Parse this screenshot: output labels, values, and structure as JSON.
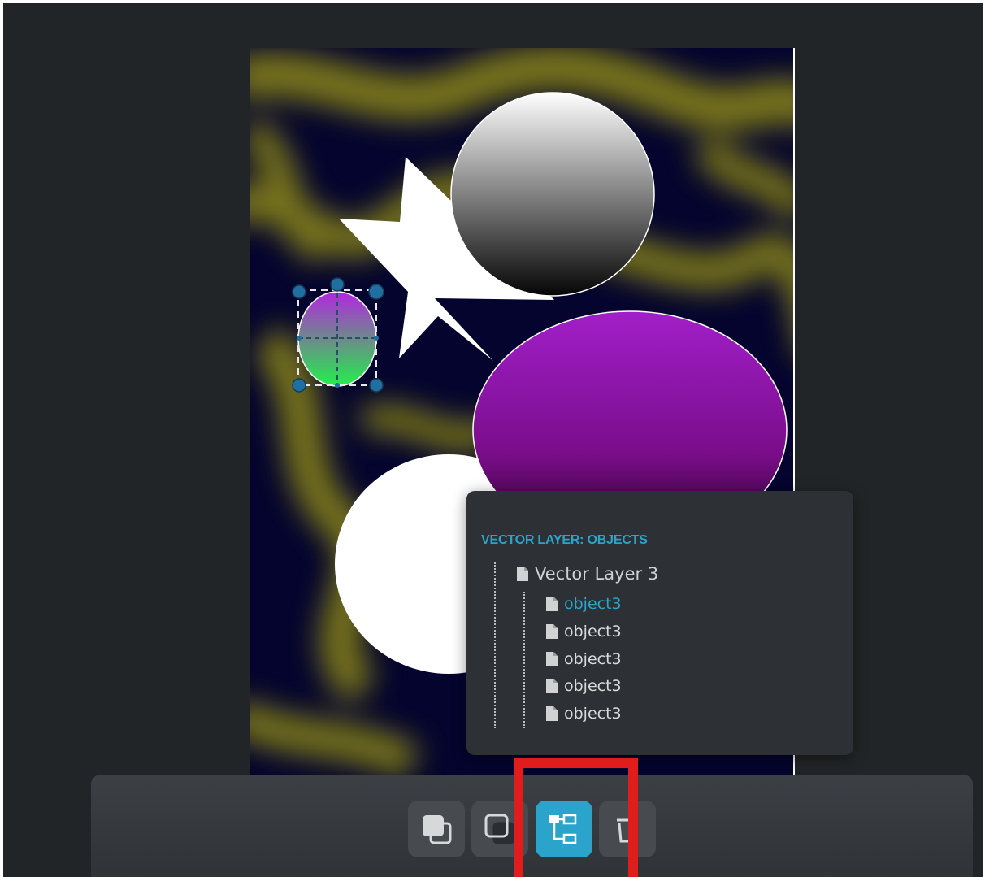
{
  "layers_panel": {
    "title": "VECTOR LAYER: OBJECTS",
    "root": {
      "label": "Vector Layer 3",
      "icon": "file-icon"
    },
    "items": [
      {
        "label": "object3",
        "active": true,
        "icon": "file-icon"
      },
      {
        "label": "object3",
        "active": false,
        "icon": "file-icon"
      },
      {
        "label": "object3",
        "active": false,
        "icon": "file-icon"
      },
      {
        "label": "object3",
        "active": false,
        "icon": "file-icon"
      },
      {
        "label": "object3",
        "active": false,
        "icon": "file-icon"
      }
    ]
  },
  "toolbar": {
    "buttons": [
      {
        "name": "bring-forward",
        "icon": "bring-forward-icon",
        "active": false
      },
      {
        "name": "send-backward",
        "icon": "send-backward-icon",
        "active": false
      },
      {
        "name": "layer-tree",
        "icon": "layer-tree-icon",
        "active": true
      },
      {
        "name": "delete",
        "icon": "trash-icon",
        "active": false
      }
    ]
  },
  "colors": {
    "accent": "#2ba4cc",
    "highlight": "#e01c1c",
    "canvas_background": "#04042e",
    "texture": "#8f8a14"
  }
}
